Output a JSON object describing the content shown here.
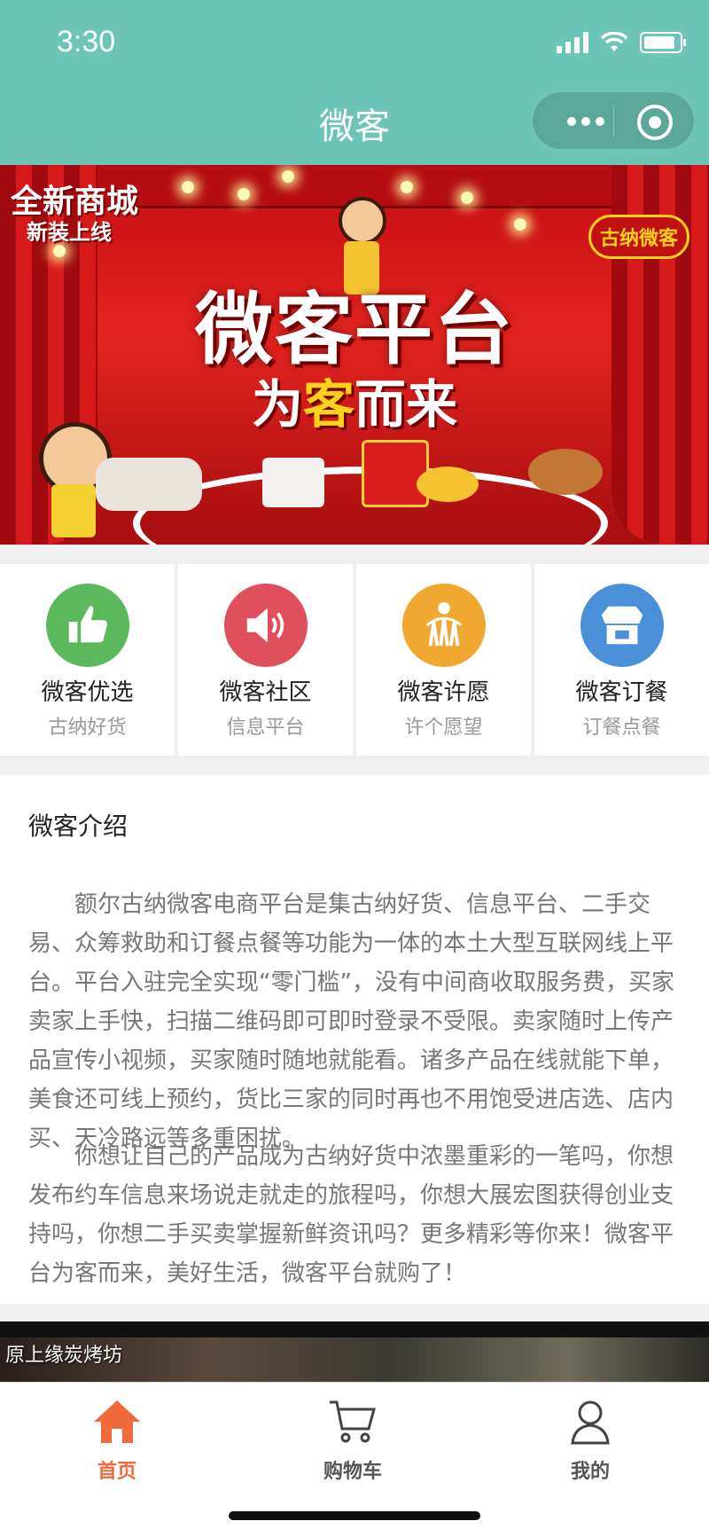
{
  "status_bar": {
    "time": "3:30"
  },
  "nav": {
    "title": "微客"
  },
  "banner": {
    "tag_line1": "全新商城",
    "tag_line2": "新装上线",
    "brand_badge": "古纳微客",
    "headline": "微客平台",
    "tagline_part1": "为",
    "tagline_highlight": "客",
    "tagline_part2": "而来"
  },
  "features": [
    {
      "title": "微客优选",
      "subtitle": "古纳好货",
      "icon": "thumbs-up-icon",
      "color": "#5cb85c"
    },
    {
      "title": "微客社区",
      "subtitle": "信息平台",
      "icon": "speaker-icon",
      "color": "#e0505c"
    },
    {
      "title": "微客许愿",
      "subtitle": "许个愿望",
      "icon": "wish-icon",
      "color": "#f0a830"
    },
    {
      "title": "微客订餐",
      "subtitle": "订餐点餐",
      "icon": "shop-icon",
      "color": "#4a90d9"
    }
  ],
  "intro": {
    "heading": "微客介绍",
    "paragraph1": "额尔古纳微客电商平台是集古纳好货、信息平台、二手交易、众筹救助和订餐点餐等功能为一体的本土大型互联网线上平台。平台入驻完全实现“零门槛”，没有中间商收取服务费，买家卖家上手快，扫描二维码即可即时登录不受限。卖家随时上传产品宣传小视频，买家随时随地就能看。诸多产品在线就能下单，美食还可线上预约，货比三家的同时再也不用饱受进店选、店内买、天冷路远等多重困扰。",
    "paragraph2": "你想让自己的产品成为古纳好货中浓墨重彩的一笔吗，你想发布约车信息来场说走就走的旅程吗，你想大展宏图获得创业支持吗，你想二手买卖掌握新鲜资讯吗？更多精彩等你来！微客平台为客而来，美好生活，微客平台就购了！"
  },
  "featured_shop": {
    "label": "原上缘炭烤坊"
  },
  "tabbar": {
    "home": "首页",
    "cart": "购物车",
    "me": "我的",
    "active_color": "#f06a3a"
  }
}
